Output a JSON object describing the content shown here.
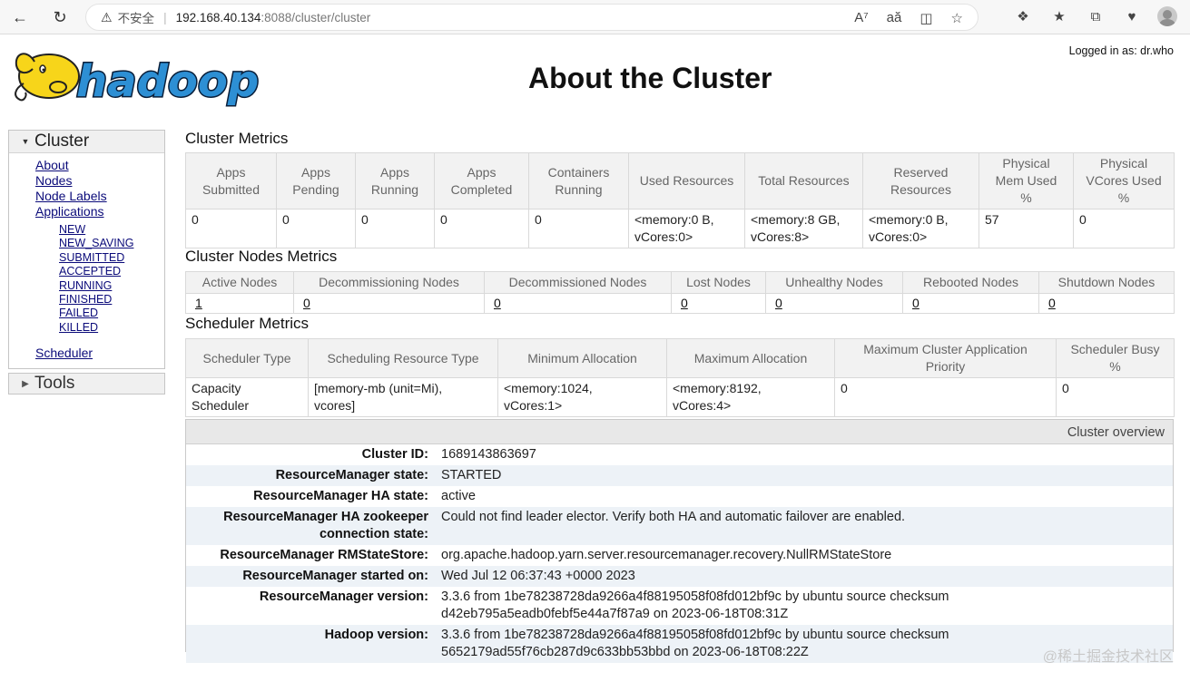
{
  "browser": {
    "address": {
      "warning_label": "不安全",
      "host": "192.168.40.134",
      "path": ":8088/cluster/cluster"
    }
  },
  "header": {
    "logo_text": "hadoop",
    "title": "About the Cluster",
    "logged_in": "Logged in as: dr.who"
  },
  "sidebar": {
    "cluster_label": "Cluster",
    "links": [
      "About",
      "Nodes",
      "Node Labels",
      "Applications"
    ],
    "app_states": [
      "NEW",
      "NEW_SAVING",
      "SUBMITTED",
      "ACCEPTED",
      "RUNNING",
      "FINISHED",
      "FAILED",
      "KILLED"
    ],
    "scheduler_link": "Scheduler",
    "tools_label": "Tools"
  },
  "cluster_metrics": {
    "title": "Cluster Metrics",
    "headers": [
      "Apps\nSubmitted",
      "Apps\nPending",
      "Apps\nRunning",
      "Apps\nCompleted",
      "Containers\nRunning",
      "Used Resources",
      "Total Resources",
      "Reserved\nResources",
      "Physical\nMem Used\n%",
      "Physical\nVCores Used\n%"
    ],
    "values": [
      "0",
      "0",
      "0",
      "0",
      "0",
      "<memory:0 B,\nvCores:0>",
      "<memory:8 GB,\nvCores:8>",
      "<memory:0 B,\nvCores:0>",
      "57",
      "0"
    ]
  },
  "node_metrics": {
    "title": "Cluster Nodes Metrics",
    "headers": [
      "Active Nodes",
      "Decommissioning Nodes",
      "Decommissioned Nodes",
      "Lost Nodes",
      "Unhealthy Nodes",
      "Rebooted Nodes",
      "Shutdown Nodes"
    ],
    "values": [
      "1",
      "0",
      "0",
      "0",
      "0",
      "0",
      "0"
    ]
  },
  "scheduler_metrics": {
    "title": "Scheduler Metrics",
    "headers": [
      "Scheduler Type",
      "Scheduling Resource Type",
      "Minimum Allocation",
      "Maximum Allocation",
      "Maximum Cluster Application\nPriority",
      "Scheduler Busy\n%"
    ],
    "values": [
      "Capacity\nScheduler",
      "[memory-mb (unit=Mi),\nvcores]",
      "<memory:1024,\nvCores:1>",
      "<memory:8192,\nvCores:4>",
      "0",
      "0"
    ]
  },
  "overview": {
    "title": "Cluster overview",
    "rows": [
      {
        "key": "Cluster ID:",
        "value": "1689143863697"
      },
      {
        "key": "ResourceManager state:",
        "value": "STARTED"
      },
      {
        "key": "ResourceManager HA state:",
        "value": "active"
      },
      {
        "key": "ResourceManager HA zookeeper\nconnection state:",
        "value": "Could not find leader elector. Verify both HA and automatic failover are enabled."
      },
      {
        "key": "ResourceManager RMStateStore:",
        "value": "org.apache.hadoop.yarn.server.resourcemanager.recovery.NullRMStateStore"
      },
      {
        "key": "ResourceManager started on:",
        "value": "Wed Jul 12 06:37:43 +0000 2023"
      },
      {
        "key": "ResourceManager version:",
        "value": "3.3.6 from 1be78238728da9266a4f88195058f08fd012bf9c by ubuntu source checksum\nd42eb795a5eadb0febf5e44a7f87a9 on 2023-06-18T08:31Z"
      },
      {
        "key": "Hadoop version:",
        "value": "3.3.6 from 1be78238728da9266a4f88195058f08fd012bf9c by ubuntu source checksum\n5652179ad55f76cb287d9c633bb53bbd on 2023-06-18T08:22Z"
      }
    ]
  },
  "watermark": "@稀土掘金技术社区"
}
